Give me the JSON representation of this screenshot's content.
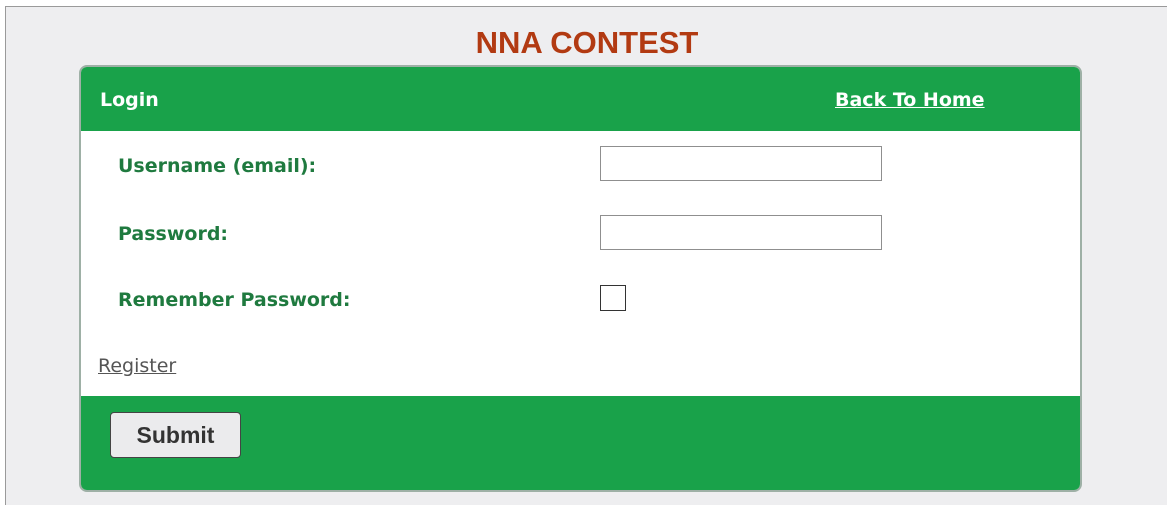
{
  "page": {
    "title": "NNA CONTEST"
  },
  "login_panel": {
    "header_title": "Login",
    "back_link": "Back To Home",
    "username_label": "Username (email):",
    "username_value": "",
    "password_label": "Password:",
    "password_value": "",
    "remember_label": "Remember Password:",
    "remember_checked": false,
    "register_link": "Register",
    "submit_label": "Submit"
  },
  "colors": {
    "accent_green": "#19a24a",
    "label_green": "#1f7a3f",
    "title_orange": "#b23a12",
    "page_background": "#eeeef0"
  }
}
